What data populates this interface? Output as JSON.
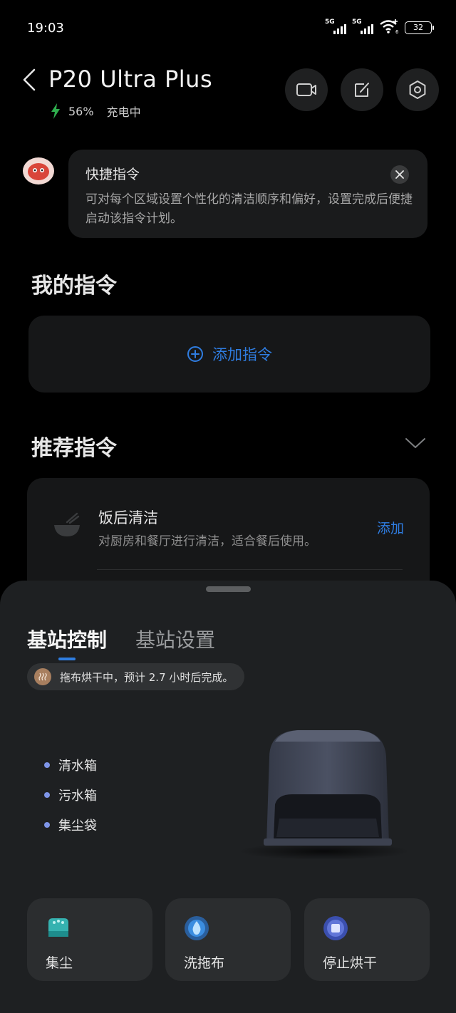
{
  "status_bar": {
    "time": "19:03",
    "sim1": "5G",
    "sim2": "5G",
    "wifi_badge": "6",
    "battery": "32"
  },
  "header": {
    "title": "P20 Ultra Plus",
    "battery_percent": "56%",
    "charging": "充电中"
  },
  "tip": {
    "title": "快捷指令",
    "body": "可对每个区域设置个性化的清洁顺序和偏好，设置完成后便捷启动该指令计划。"
  },
  "my_commands": {
    "title": "我的指令",
    "add_label": "添加指令"
  },
  "recommended": {
    "title": "推荐指令",
    "items": [
      {
        "title": "饭后清洁",
        "desc": "对厨房和餐厅进行清洁，适合餐后使用。",
        "action": "添加"
      }
    ]
  },
  "sheet": {
    "tabs": [
      {
        "label": "基站控制"
      },
      {
        "label": "基站设置"
      }
    ],
    "status_text": "拖布烘干中，预计 2.7 小时后完成。",
    "bullets": [
      "清水箱",
      "污水箱",
      "集尘袋"
    ],
    "actions": [
      {
        "label": "集尘"
      },
      {
        "label": "洗拖布"
      },
      {
        "label": "停止烘干"
      }
    ]
  },
  "colors": {
    "accent": "#2f7de1",
    "bullet": "#7e95e8",
    "charging_bolt": "#2fae4e"
  }
}
